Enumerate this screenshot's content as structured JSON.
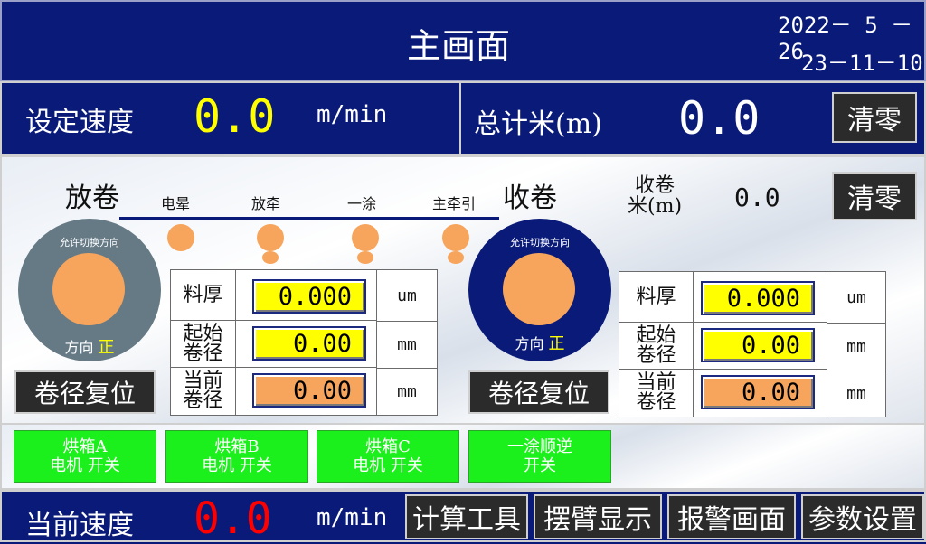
{
  "header": {
    "title": "主画面",
    "date": "2022－ 5 －26",
    "time": "23－11－10"
  },
  "speed_bar": {
    "set_speed_label": "设定速度",
    "set_speed_value": "0.0",
    "set_speed_unit": "m/min",
    "total_meter_label": "总计米(m)",
    "total_meter_value": "0.0",
    "clear_label": "清零"
  },
  "unwind": {
    "title": "放卷",
    "allow_switch": "允许切换方向",
    "direction_label": "方向",
    "direction_value": "正",
    "reset_label": "卷径复位",
    "rows": [
      {
        "label": "料厚",
        "value": "0.000",
        "unit": "um"
      },
      {
        "label": "起始\n卷径",
        "value": "0.00",
        "unit": "mm"
      },
      {
        "label": "当前\n卷径",
        "value": "0.00",
        "unit": "mm"
      }
    ]
  },
  "rewind": {
    "title": "收卷",
    "meter_label": "收卷\n米(m)",
    "meter_value": "0.0",
    "clear_label": "清零",
    "allow_switch": "允许切换方向",
    "direction_label": "方向",
    "direction_value": "正",
    "reset_label": "卷径复位",
    "rows": [
      {
        "label": "料厚",
        "value": "0.000",
        "unit": "um"
      },
      {
        "label": "起始\n卷径",
        "value": "0.00",
        "unit": "mm"
      },
      {
        "label": "当前\n卷径",
        "value": "0.00",
        "unit": "mm"
      }
    ]
  },
  "process": {
    "labels": [
      "电晕",
      "放牵",
      "一涂",
      "主牵引"
    ]
  },
  "switches": [
    {
      "line1": "烘箱A",
      "line2": "电机 开关"
    },
    {
      "line1": "烘箱B",
      "line2": "电机 开关"
    },
    {
      "line1": "烘箱C",
      "line2": "电机 开关"
    },
    {
      "line1": "一涂顺逆",
      "line2": "开关"
    }
  ],
  "footer": {
    "current_speed_label": "当前速度",
    "current_speed_value": "0.0",
    "current_speed_unit": "m/min",
    "buttons": [
      "计算工具",
      "摆臂显示",
      "报警画面",
      "参数设置"
    ]
  },
  "colors": {
    "navy": "#0a1a78",
    "yellow_value": "#ffff00",
    "red_value": "#ff0000",
    "orange": "#f7a55c",
    "green": "#1cf01c",
    "roll_gray": "#667a85"
  }
}
